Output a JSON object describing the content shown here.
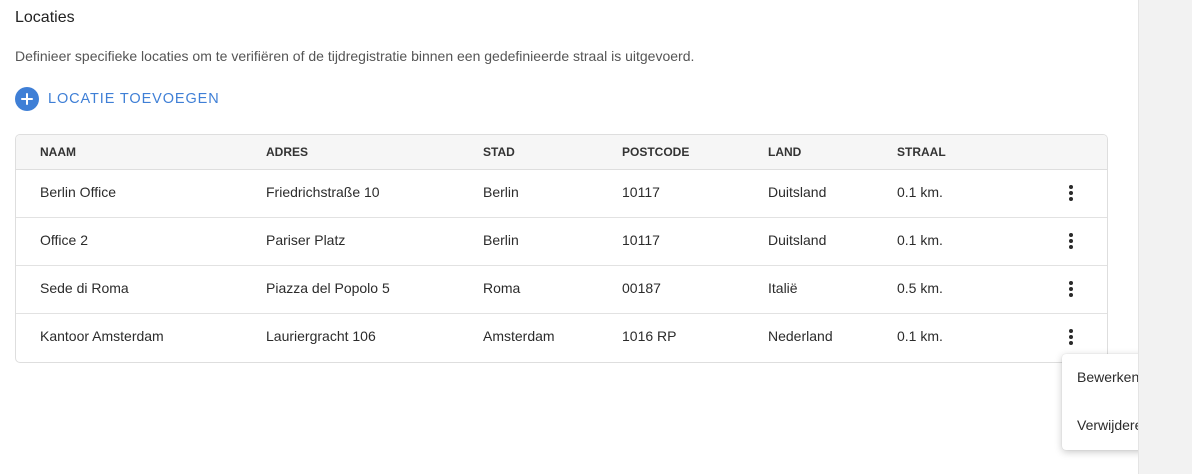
{
  "section": {
    "title": "Locaties",
    "description": "Definieer specifieke locaties om te verifiëren of de tijdregistratie binnen een gedefinieerde straal is uitgevoerd."
  },
  "add_button": {
    "icon": "plus-circle-icon",
    "label": "LOCATIE TOEVOEGEN",
    "color": "#3f7fd6"
  },
  "table": {
    "columns": [
      "NAAM",
      "ADRES",
      "STAD",
      "POSTCODE",
      "LAND",
      "STRAAL"
    ],
    "rows": [
      [
        "Berlin Office",
        "Friedrichstraße 10",
        "Berlin",
        "10117",
        "Duitsland",
        "0.1 km."
      ],
      [
        "Office 2",
        "Pariser Platz",
        "Berlin",
        "10117",
        "Duitsland",
        "0.1 km."
      ],
      [
        "Sede di Roma",
        "Piazza del Popolo 5",
        "Roma",
        "00187",
        "Italië",
        "0.5 km."
      ],
      [
        "Kantoor Amsterdam",
        "Lauriergracht 106",
        "Amsterdam",
        "1016 RP",
        "Nederland",
        "0.1 km."
      ]
    ],
    "row_action_icon": "more-vertical-icon"
  },
  "context_menu": {
    "items": [
      "Bewerken",
      "Verwijderen"
    ]
  }
}
